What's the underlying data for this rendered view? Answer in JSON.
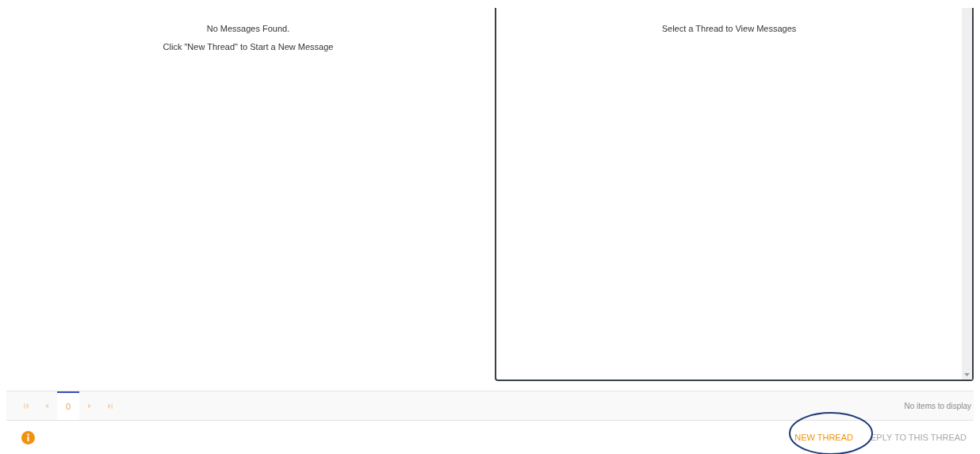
{
  "thread_list": {
    "empty_title": "No Messages Found.",
    "empty_hint": "Click \"New Thread\" to Start a New Message"
  },
  "message_view": {
    "placeholder_text": "Select a Thread to View Messages"
  },
  "pager": {
    "nav_disabled": true,
    "pages": [
      {
        "label": "0",
        "selected": true
      }
    ],
    "status": "No items to display"
  },
  "actions": [
    {
      "label": "NEW THREAD",
      "disabled": false
    },
    {
      "label": "EPLY TO THIS THREAD",
      "disabled": true
    }
  ],
  "annotation": {
    "kind": "ellipse",
    "color": "#1f3a7a"
  }
}
